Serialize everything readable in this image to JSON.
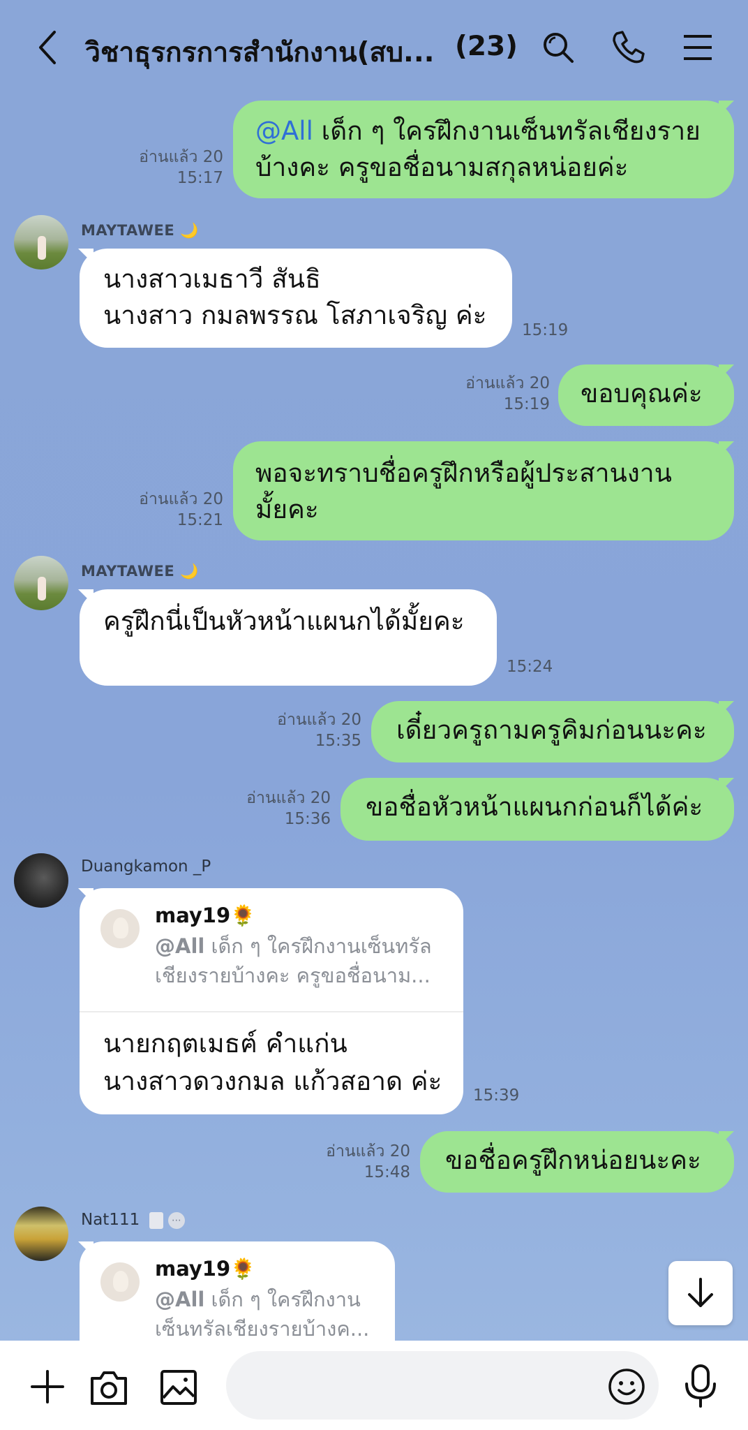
{
  "header": {
    "title": "วิชาธุรกรการสำนักงาน(สบ...",
    "member_count": "(23)",
    "icons": [
      "back-arrow-icon",
      "search-icon",
      "phone-icon",
      "menu-icon"
    ]
  },
  "messages": [
    {
      "type": "out",
      "mention": "@All",
      "text_line1": " เด็ก ๆ ใครฝึกงานเซ็นทรัลเชียงราย",
      "text_line2": "บ้างคะ ครูขอชื่อนามสกุลหน่อยค่ะ",
      "read": "อ่านแล้ว 20",
      "time": "15:17"
    },
    {
      "type": "in",
      "sender": "MAYTAWEE",
      "sender_emoji": "🌙",
      "line1": "นางสาวเมธาวี สันธิ",
      "line2": "นางสาว กมลพรรณ โสภาเจริญ ค่ะ",
      "time": "15:19"
    },
    {
      "type": "out",
      "text": "ขอบคุณค่ะ",
      "read": "อ่านแล้ว 20",
      "time": "15:19"
    },
    {
      "type": "out",
      "text_line1": "พอจะทราบชื่อครูฝึกหรือผู้ประสานงาน",
      "text_line2": "มั้ยคะ",
      "read": "อ่านแล้ว 20",
      "time": "15:21"
    },
    {
      "type": "in",
      "sender": "MAYTAWEE",
      "sender_emoji": "🌙",
      "text": "ครูฝึกนี่เป็นหัวหน้าแผนกได้มั้ยคะ",
      "time": "15:24"
    },
    {
      "type": "out",
      "text": "เดี๋ยวครูถามครูคิมก่อนนะคะ",
      "read": "อ่านแล้ว 20",
      "time": "15:35"
    },
    {
      "type": "out",
      "text": "ขอชื่อหัวหน้าแผนกก่อนก็ได้ค่ะ",
      "read": "อ่านแล้ว 20",
      "time": "15:36"
    },
    {
      "type": "in-reply",
      "sender": "Duangkamon _P",
      "reply_name": "may19🌻",
      "reply_mention": "@All",
      "reply_line1": " เด็ก ๆ ใครฝึกงานเซ็นทรัล",
      "reply_line2": "เชียงรายบ้างคะ ครูขอชื่อนาม...",
      "line1": "นายกฤตเมธฅ์ คำแก่น",
      "line2": "นางสาวดวงกมล แก้วสอาด ค่ะ",
      "time": "15:39"
    },
    {
      "type": "out",
      "text": "ขอชื่อครูฝึกหน่อยนะคะ",
      "read": "อ่านแล้ว 20",
      "time": "15:48"
    },
    {
      "type": "in-reply",
      "sender": "Nat111",
      "reply_name": "may19🌻",
      "reply_mention": "@All",
      "reply_line1": " เด็ก ๆ ใครฝึกงาน",
      "reply_line2": "เซ็นทรัลเชียงรายบ้างค..."
    }
  ],
  "bottom_bar": {
    "icons": [
      "plus-icon",
      "camera-icon",
      "image-icon",
      "emoji-icon",
      "microphone-icon"
    ],
    "input_placeholder": ""
  },
  "colors": {
    "outgoing": "#9de491",
    "incoming": "#ffffff",
    "mention": "#2f6fd6",
    "background": "#8aa6d8"
  }
}
